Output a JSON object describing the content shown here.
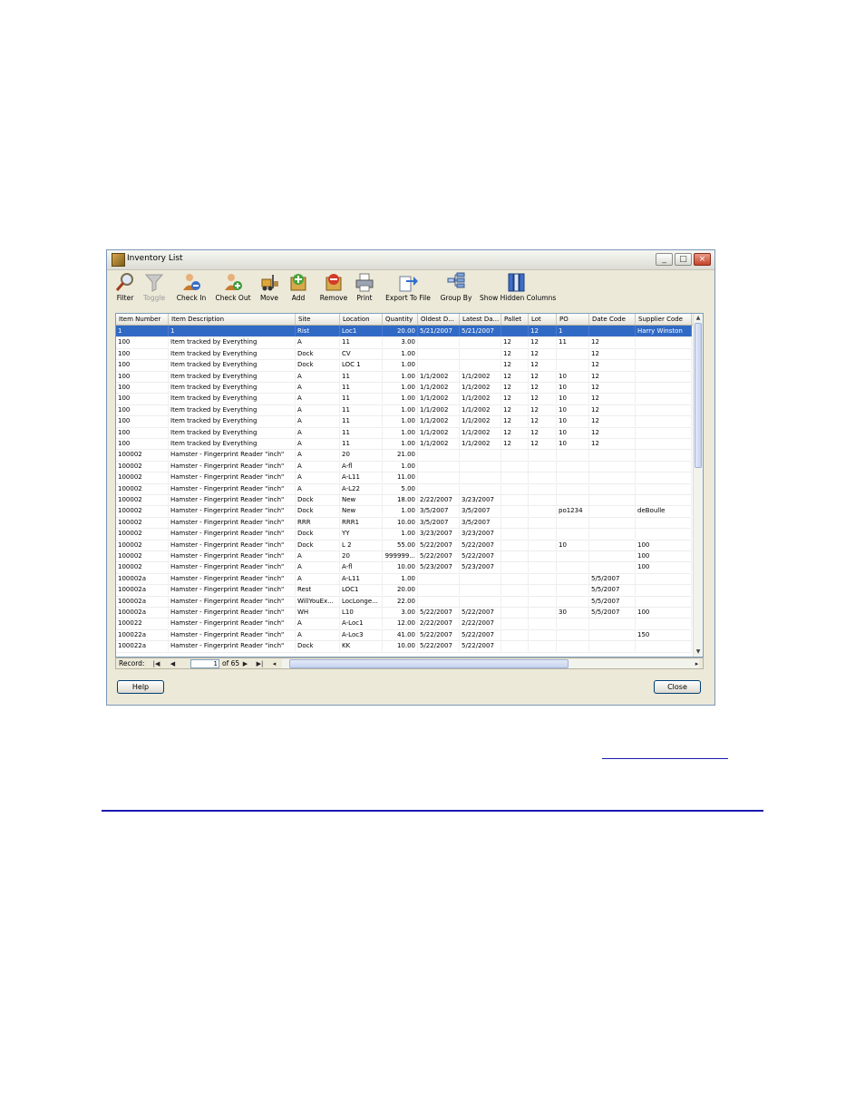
{
  "window": {
    "title": "Inventory List",
    "controls": {
      "minimize": "_",
      "maximize": "□",
      "close": "×"
    }
  },
  "toolbar": {
    "items": [
      {
        "label": "Filter",
        "icon": "magnifier-icon",
        "enabled": true
      },
      {
        "label": "Toggle",
        "icon": "funnel-icon",
        "enabled": false
      },
      {
        "label": "Check In",
        "icon": "user-check-in-icon",
        "enabled": true
      },
      {
        "label": "Check Out",
        "icon": "user-check-out-icon",
        "enabled": true
      },
      {
        "label": "Move",
        "icon": "forklift-icon",
        "enabled": true
      },
      {
        "label": "Add",
        "icon": "add-box-icon",
        "enabled": true
      },
      {
        "label": "Remove",
        "icon": "remove-box-icon",
        "enabled": true
      },
      {
        "label": "Print",
        "icon": "printer-icon",
        "enabled": true
      },
      {
        "label": "Export To File",
        "icon": "export-icon",
        "enabled": true
      },
      {
        "label": "Group By",
        "icon": "group-by-icon",
        "enabled": true
      },
      {
        "label": "Show Hidden Columns",
        "icon": "columns-icon",
        "enabled": true
      }
    ]
  },
  "grid": {
    "columns": [
      "Item Number",
      "Item Description",
      "Site",
      "Location",
      "Quantity",
      "Oldest D...",
      "Latest Da...",
      "Pallet",
      "Lot",
      "PO",
      "Date Code",
      "Supplier Code"
    ],
    "selected_row": 0,
    "rows": [
      [
        "1",
        "1",
        "Rist",
        "Loc1",
        "20.00",
        "5/21/2007",
        "5/21/2007",
        "",
        "12",
        "1",
        "",
        "Harry Winston"
      ],
      [
        "100",
        "Item tracked by Everything",
        "A",
        "11",
        "3.00",
        "",
        "",
        "12",
        "12",
        "11",
        "12",
        ""
      ],
      [
        "100",
        "Item tracked by Everything",
        "Dock",
        "CV",
        "1.00",
        "",
        "",
        "12",
        "12",
        "",
        "12",
        ""
      ],
      [
        "100",
        "Item tracked by Everything",
        "Dock",
        "LOC 1",
        "1.00",
        "",
        "",
        "12",
        "12",
        "",
        "12",
        ""
      ],
      [
        "100",
        "Item tracked by Everything",
        "A",
        "11",
        "1.00",
        "1/1/2002",
        "1/1/2002",
        "12",
        "12",
        "10",
        "12",
        ""
      ],
      [
        "100",
        "Item tracked by Everything",
        "A",
        "11",
        "1.00",
        "1/1/2002",
        "1/1/2002",
        "12",
        "12",
        "10",
        "12",
        ""
      ],
      [
        "100",
        "Item tracked by Everything",
        "A",
        "11",
        "1.00",
        "1/1/2002",
        "1/1/2002",
        "12",
        "12",
        "10",
        "12",
        ""
      ],
      [
        "100",
        "Item tracked by Everything",
        "A",
        "11",
        "1.00",
        "1/1/2002",
        "1/1/2002",
        "12",
        "12",
        "10",
        "12",
        ""
      ],
      [
        "100",
        "Item tracked by Everything",
        "A",
        "11",
        "1.00",
        "1/1/2002",
        "1/1/2002",
        "12",
        "12",
        "10",
        "12",
        ""
      ],
      [
        "100",
        "Item tracked by Everything",
        "A",
        "11",
        "1.00",
        "1/1/2002",
        "1/1/2002",
        "12",
        "12",
        "10",
        "12",
        ""
      ],
      [
        "100",
        "Item tracked by Everything",
        "A",
        "11",
        "1.00",
        "1/1/2002",
        "1/1/2002",
        "12",
        "12",
        "10",
        "12",
        ""
      ],
      [
        "100002",
        "Hamster - Fingerprint Reader \"inch\"",
        "A",
        "20",
        "21.00",
        "",
        "",
        "",
        "",
        "",
        "",
        ""
      ],
      [
        "100002",
        "Hamster - Fingerprint Reader \"inch\"",
        "A",
        "A-fl",
        "1.00",
        "",
        "",
        "",
        "",
        "",
        "",
        ""
      ],
      [
        "100002",
        "Hamster - Fingerprint Reader \"inch\"",
        "A",
        "A-L11",
        "11.00",
        "",
        "",
        "",
        "",
        "",
        "",
        ""
      ],
      [
        "100002",
        "Hamster - Fingerprint Reader \"inch\"",
        "A",
        "A-L22",
        "5.00",
        "",
        "",
        "",
        "",
        "",
        "",
        ""
      ],
      [
        "100002",
        "Hamster - Fingerprint Reader \"inch\"",
        "Dock",
        "New",
        "18.00",
        "2/22/2007",
        "3/23/2007",
        "",
        "",
        "",
        "",
        ""
      ],
      [
        "100002",
        "Hamster - Fingerprint Reader \"inch\"",
        "Dock",
        "New",
        "1.00",
        "3/5/2007",
        "3/5/2007",
        "",
        "",
        "po1234",
        "",
        "deBoulle"
      ],
      [
        "100002",
        "Hamster - Fingerprint Reader \"inch\"",
        "RRR",
        "RRR1",
        "10.00",
        "3/5/2007",
        "3/5/2007",
        "",
        "",
        "",
        "",
        ""
      ],
      [
        "100002",
        "Hamster - Fingerprint Reader \"inch\"",
        "Dock",
        "YY",
        "1.00",
        "3/23/2007",
        "3/23/2007",
        "",
        "",
        "",
        "",
        ""
      ],
      [
        "100002",
        "Hamster - Fingerprint Reader \"inch\"",
        "Dock",
        "L 2",
        "55.00",
        "5/22/2007",
        "5/22/2007",
        "",
        "",
        "10",
        "",
        "100"
      ],
      [
        "100002",
        "Hamster - Fingerprint Reader \"inch\"",
        "A",
        "20",
        "999999...",
        "5/22/2007",
        "5/22/2007",
        "",
        "",
        "",
        "",
        "100"
      ],
      [
        "100002",
        "Hamster - Fingerprint Reader \"inch\"",
        "A",
        "A-fl",
        "10.00",
        "5/23/2007",
        "5/23/2007",
        "",
        "",
        "",
        "",
        "100"
      ],
      [
        "100002a",
        "Hamster - Fingerprint Reader \"inch\"",
        "A",
        "A-L11",
        "1.00",
        "",
        "",
        "",
        "",
        "",
        "5/5/2007",
        ""
      ],
      [
        "100002a",
        "Hamster - Fingerprint Reader \"inch\"",
        "Rest",
        "LOC1",
        "20.00",
        "",
        "",
        "",
        "",
        "",
        "5/5/2007",
        ""
      ],
      [
        "100002a",
        "Hamster - Fingerprint Reader \"inch\"",
        "WillYouEx...",
        "LocLonge...",
        "22.00",
        "",
        "",
        "",
        "",
        "",
        "5/5/2007",
        ""
      ],
      [
        "100002a",
        "Hamster - Fingerprint Reader \"inch\"",
        "WH",
        "L10",
        "3.00",
        "5/22/2007",
        "5/22/2007",
        "",
        "",
        "30",
        "5/5/2007",
        "100"
      ],
      [
        "100022",
        "Hamster - Fingerprint Reader \"inch\"",
        "A",
        "A-Loc1",
        "12.00",
        "2/22/2007",
        "2/22/2007",
        "",
        "",
        "",
        "",
        ""
      ],
      [
        "100022a",
        "Hamster - Fingerprint Reader \"inch\"",
        "A",
        "A-Loc3",
        "41.00",
        "5/22/2007",
        "5/22/2007",
        "",
        "",
        "",
        "",
        "150"
      ],
      [
        "100022a",
        "Hamster - Fingerprint Reader \"inch\"",
        "Dock",
        "KK",
        "10.00",
        "5/22/2007",
        "5/22/2007",
        "",
        "",
        "",
        "",
        ""
      ]
    ]
  },
  "navigator": {
    "label": "Record:",
    "current": "1",
    "of_label": "of",
    "total": "65"
  },
  "buttons": {
    "help": "Help",
    "close": "Close"
  },
  "colors": {
    "selection": "#316ac5",
    "window_bg": "#ece9d8",
    "link": "#1a1ab0"
  }
}
